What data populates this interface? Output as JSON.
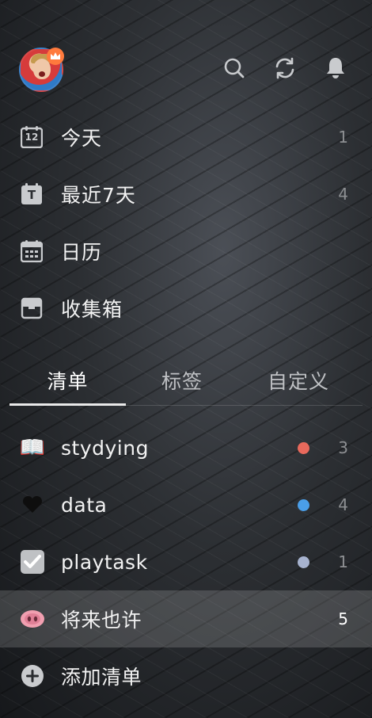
{
  "header": {
    "avatar_icon": "user-avatar",
    "badge_icon": "crown-icon",
    "actions": [
      {
        "icon": "search-icon"
      },
      {
        "icon": "sync-icon"
      },
      {
        "icon": "bell-icon"
      }
    ]
  },
  "smart_lists": [
    {
      "label": "今天",
      "count": "1",
      "icon": "calendar-day-icon",
      "icon_text": "12"
    },
    {
      "label": "最近7天",
      "count": "4",
      "icon": "calendar-week-icon",
      "icon_text": "T"
    },
    {
      "label": "日历",
      "count": "",
      "icon": "calendar-icon",
      "icon_text": ""
    },
    {
      "label": "收集箱",
      "count": "",
      "icon": "inbox-icon",
      "icon_text": ""
    }
  ],
  "tabs": [
    {
      "label": "清单",
      "active": true
    },
    {
      "label": "标签",
      "active": false
    },
    {
      "label": "自定义",
      "active": false
    }
  ],
  "lists": [
    {
      "label": "stydying",
      "icon": "open-book-icon",
      "emoji": "📖",
      "dot_color": "#e8695c",
      "count": "3",
      "selected": false
    },
    {
      "label": "data",
      "icon": "heart-icon",
      "emoji": "❤",
      "dot_color": "#4a9ee8",
      "count": "4",
      "selected": false
    },
    {
      "label": "playtask",
      "icon": "checkbox-icon",
      "emoji": "✔",
      "dot_color": "#a7b3cf",
      "count": "1",
      "selected": false
    },
    {
      "label": "将来也许",
      "icon": "pig-nose-icon",
      "emoji": "",
      "dot_color": "",
      "count": "5",
      "selected": true
    }
  ],
  "add_list": {
    "label": "添加清单",
    "icon": "plus-circle-icon"
  },
  "colors": {
    "accent_orange": "#ff7a3d",
    "text_primary": "#f2f2f2",
    "text_muted": "#8d8f92"
  }
}
